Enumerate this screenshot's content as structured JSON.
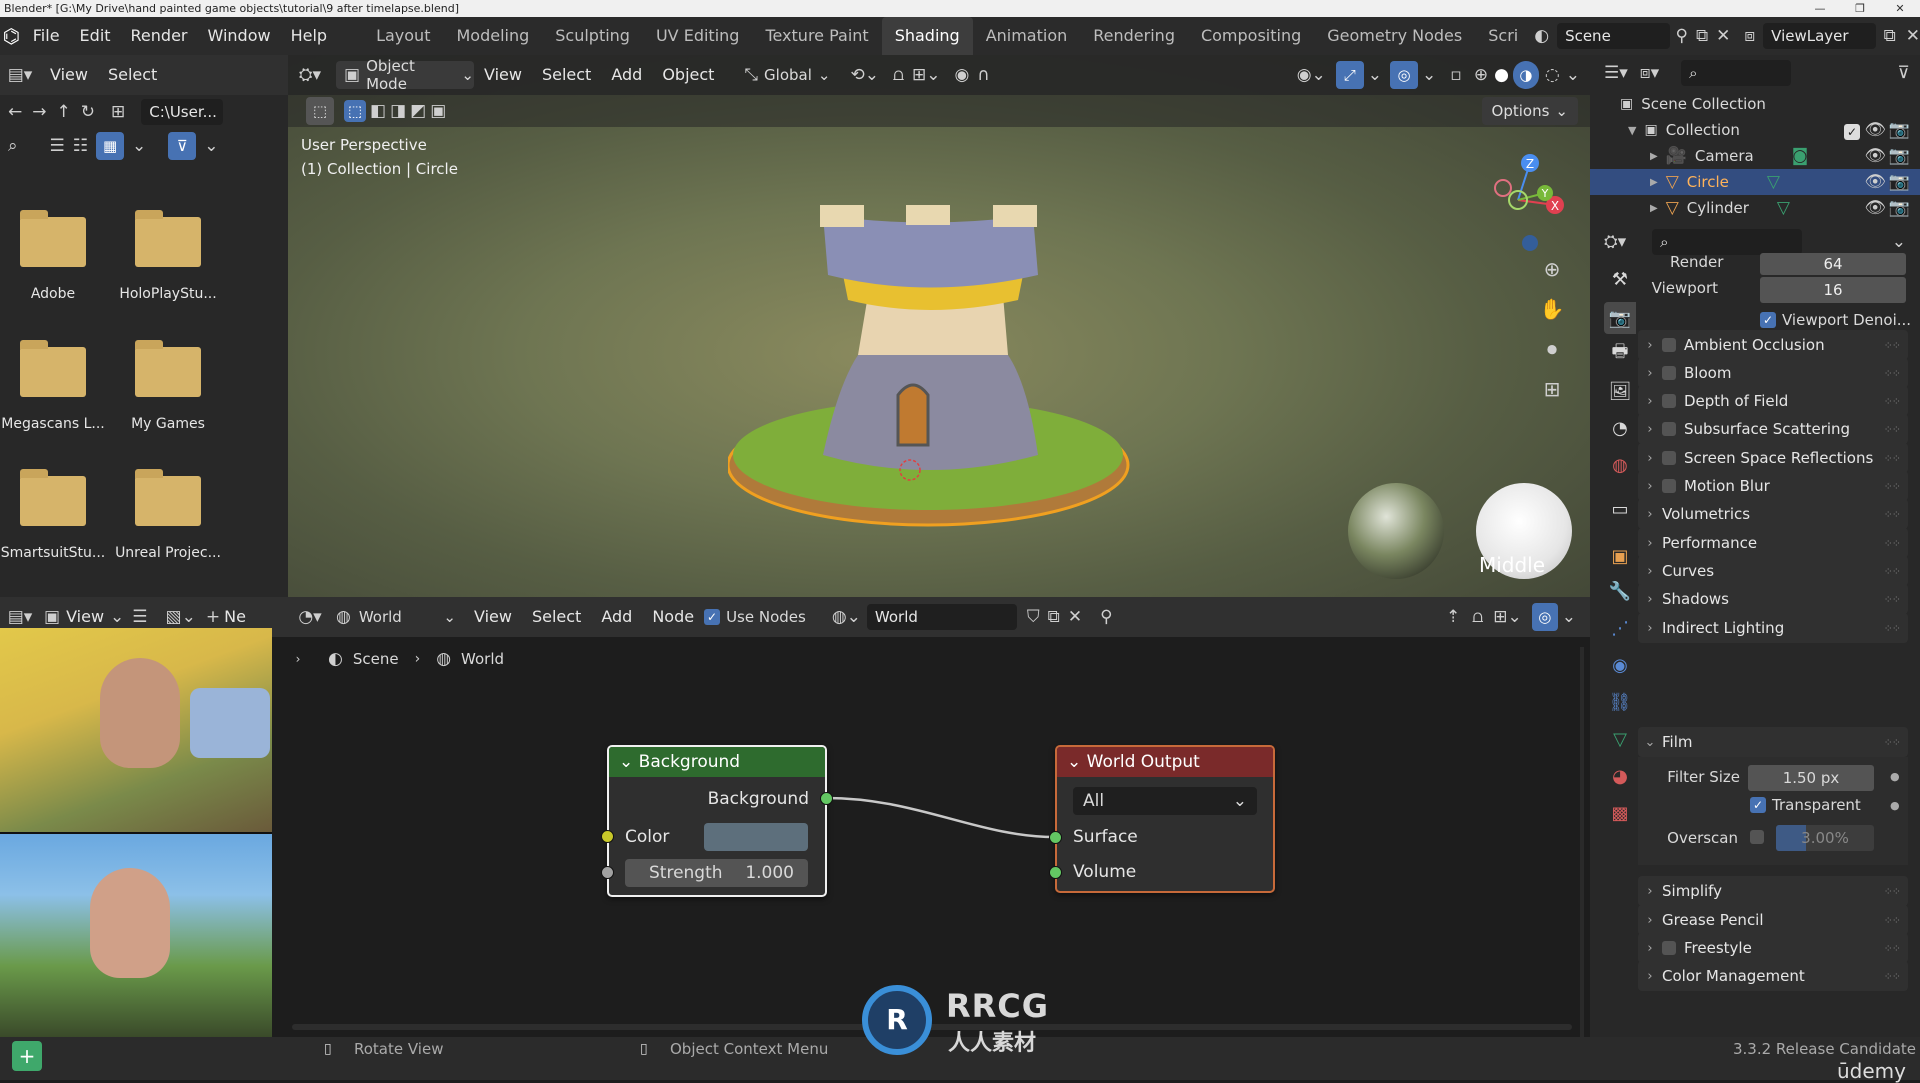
{
  "window": {
    "title": "Blender* [G:\\My Drive\\hand painted game objects\\tutorial\\9 after timelapse.blend]",
    "controls": [
      "—",
      "❐",
      "✕"
    ]
  },
  "menu": [
    "File",
    "Edit",
    "Render",
    "Window",
    "Help"
  ],
  "workspaces": [
    "Layout",
    "Modeling",
    "Sculpting",
    "UV Editing",
    "Texture Paint",
    "Shading",
    "Animation",
    "Rendering",
    "Compositing",
    "Geometry Nodes",
    "Scri"
  ],
  "active_workspace": "Shading",
  "scene": {
    "name": "Scene",
    "view_layer": "ViewLayer"
  },
  "filebrowser": {
    "menus": [
      "View",
      "Select"
    ],
    "path": "C:\\User...",
    "folders": [
      "Adobe",
      "HoloPlayStu...",
      "Megascans L...",
      "My Games",
      "SmartsuitStu...",
      "Unreal Projec..."
    ]
  },
  "viewport": {
    "mode": "Object Mode",
    "menus": [
      "View",
      "Select",
      "Add",
      "Object"
    ],
    "orientation": "Global",
    "options": "Options",
    "perspective": "User Perspective",
    "context": "(1) Collection | Circle",
    "hdri_label": "Middle",
    "axes": {
      "z": "Z",
      "y": "Y",
      "x": "X"
    }
  },
  "node_editor": {
    "world_type": "World",
    "menus": [
      "View",
      "Select",
      "Add",
      "Node"
    ],
    "use_nodes": "Use Nodes",
    "world_name": "World",
    "breadcrumb": [
      "Scene",
      "World"
    ],
    "background_node": {
      "title": "Background",
      "output": "Background",
      "color_label": "Color",
      "strength_label": "Strength",
      "strength_value": "1.000"
    },
    "output_node": {
      "title": "World Output",
      "target": "All",
      "surface": "Surface",
      "volume": "Volume"
    }
  },
  "left_editor_header": {
    "view": "View",
    "new": "Ne"
  },
  "outliner": {
    "root": "Scene Collection",
    "collection": "Collection",
    "items": [
      "Camera",
      "Circle",
      "Cylinder"
    ]
  },
  "properties": {
    "render_label": "Render",
    "render_value": "64",
    "viewport_label": "Viewport",
    "viewport_value": "16",
    "viewport_denoise": "Viewport Denoi...",
    "sections": [
      "Ambient Occlusion",
      "Bloom",
      "Depth of Field",
      "Subsurface Scattering",
      "Screen Space Reflections",
      "Motion Blur",
      "Volumetrics",
      "Performance",
      "Curves",
      "Shadows",
      "Indirect Lighting",
      "Film"
    ],
    "film": {
      "filter_label": "Filter Size",
      "filter_value": "1.50 px",
      "transparent": "Transparent",
      "overscan_label": "Overscan",
      "overscan_value": "3.00%"
    },
    "sections_after": [
      "Simplify",
      "Grease Pencil",
      "Freestyle",
      "Color Management"
    ]
  },
  "statusbar": {
    "rotate": "Rotate View",
    "context_menu": "Object Context Menu",
    "version": "3.3.2 Release Candidate"
  },
  "watermark": {
    "logo": "RRCG",
    "sub": "人人素材",
    "udemy": "ūdemy"
  },
  "colors": {
    "accent": "#4772b3",
    "node_green": "#2e6b2e",
    "node_red": "#7a2a2a",
    "socket_yellow": "#c7c729",
    "socket_green": "#63c763"
  }
}
